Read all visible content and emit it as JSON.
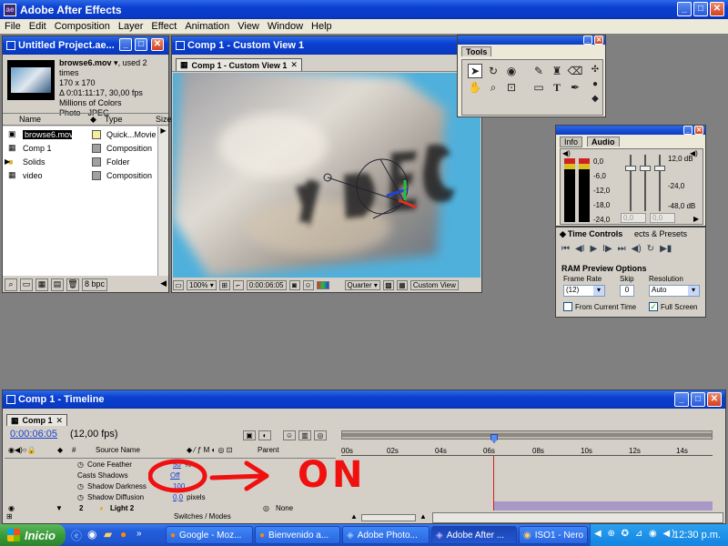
{
  "app": {
    "title": "Adobe After Effects"
  },
  "menubar": {
    "items": [
      "File",
      "Edit",
      "Composition",
      "Layer",
      "Effect",
      "Animation",
      "View",
      "Window",
      "Help"
    ]
  },
  "project": {
    "title": "Untitled Project.ae...",
    "footage_name": "browse6.mov",
    "used_count": ", used 2 times",
    "dimensions": "170 x 170",
    "duration": "Δ 0:01:11:17, 30,00 fps",
    "colors": "Millions of Colors",
    "codec": "Photo - JPEG",
    "columns": [
      "Name",
      "Type",
      "Size"
    ],
    "items": [
      {
        "name": "browse6.mov",
        "type": "Quick...Movie",
        "color": "#f2ee9c"
      },
      {
        "name": "Comp 1",
        "type": "Composition",
        "color": "#a0a0a0"
      },
      {
        "name": "Solids",
        "type": "Folder",
        "color": "#a0a0a0"
      },
      {
        "name": "video",
        "type": "Composition",
        "color": "#a0a0a0"
      }
    ],
    "bpc": "8 bpc"
  },
  "comp_viewer": {
    "title": "Comp 1 - Custom View 1",
    "tab": "Comp 1 - Custom View 1",
    "zoom": "100%",
    "timecode": "0:00:06:05",
    "resolution": "Quarter",
    "view": "Custom View"
  },
  "tools": {
    "title": "Tools"
  },
  "audio_panel": {
    "tabs": [
      "Info",
      "Audio"
    ],
    "left_scale": [
      "0,0",
      "-6,0",
      "-12,0",
      "-18,0",
      "-24,0"
    ],
    "right_scale": [
      "12,0 dB",
      "-24,0",
      "-48,0 dB"
    ],
    "readouts": [
      "0,0",
      "0,0"
    ]
  },
  "time_controls": {
    "tabs": [
      "Time Controls",
      "ects & Presets"
    ],
    "ram_preview_label": "RAM Preview Options",
    "frame_rate_label": "Frame Rate",
    "frame_rate_value": "(12)",
    "skip_label": "Skip",
    "skip_value": "0",
    "resolution_label": "Resolution",
    "resolution_value": "Auto",
    "from_current_time": "From Current Time",
    "full_screen": "Full Screen",
    "from_current_time_checked": false,
    "full_screen_checked": true
  },
  "timeline": {
    "title": "Comp 1 - Timeline",
    "tab": "Comp 1",
    "timecode": "0:00:06:05",
    "fps": "(12,00 fps)",
    "col_source": "Source Name",
    "col_parent": "Parent",
    "ticks": [
      "00s",
      "02s",
      "04s",
      "06s",
      "08s",
      "10s",
      "12s",
      "14s"
    ],
    "rows": [
      {
        "label": "Cone Feather",
        "value": "50",
        "unit": "%"
      },
      {
        "label": "Casts Shadows",
        "value": "Off",
        "unit": ""
      },
      {
        "label": "Shadow Darkness",
        "value": "100",
        "unit": ""
      },
      {
        "label": "Shadow Diffusion",
        "value": "0,0",
        "unit": "pixels"
      }
    ],
    "layer_num": "2",
    "layer_name": "Light 2",
    "parent_value": "None",
    "switches_modes": "Switches / Modes",
    "annotation": "ON"
  },
  "taskbar": {
    "start": "Inicio",
    "tasks": [
      "Google - Moz...",
      "Bienvenido a...",
      "Adobe Photo...",
      "Adobe After ...",
      "ISO1 - Nero ..."
    ],
    "clock": "12:30 p.m."
  }
}
